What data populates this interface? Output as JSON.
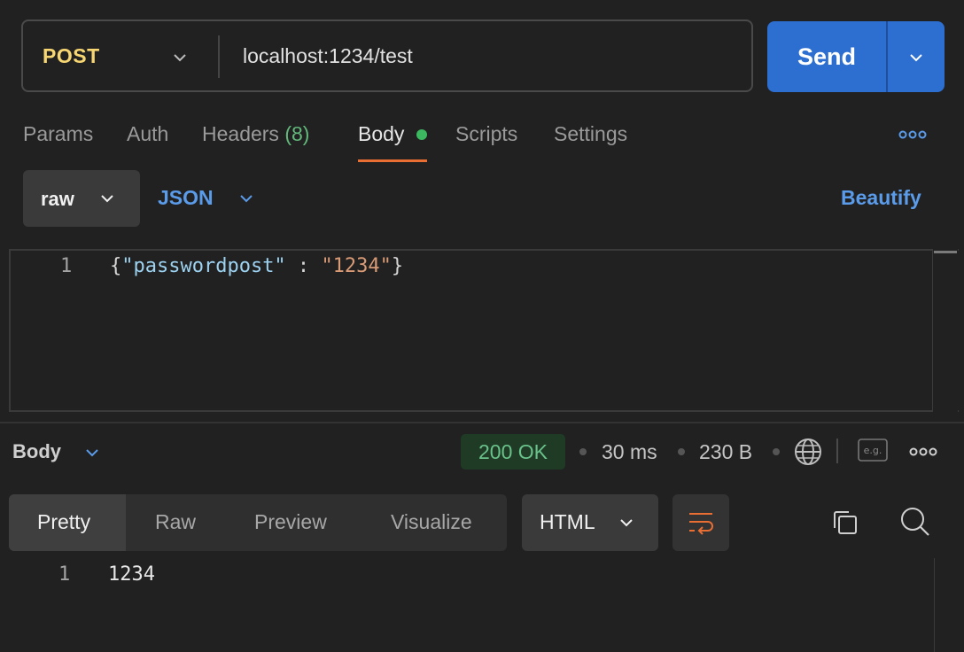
{
  "request": {
    "method": "POST",
    "url": "localhost:1234/test",
    "send_label": "Send"
  },
  "tabs": {
    "params": "Params",
    "auth": "Auth",
    "headers": "Headers",
    "headers_count": "(8)",
    "body": "Body",
    "scripts": "Scripts",
    "settings": "Settings"
  },
  "body_options": {
    "mode": "raw",
    "format": "JSON",
    "beautify": "Beautify"
  },
  "editor": {
    "line_number": "1",
    "brace_open": "{",
    "key": "\"passwordpost\"",
    "colon": " : ",
    "value": "\"1234\"",
    "brace_close": "}"
  },
  "response": {
    "label": "Body",
    "status": "200 OK",
    "time": "30 ms",
    "size": "230 B",
    "eg_label": "e.g.",
    "view_tabs": [
      "Pretty",
      "Raw",
      "Preview",
      "Visualize"
    ],
    "language": "HTML",
    "line_number": "1",
    "content": "1234"
  },
  "colors": {
    "accent_blue": "#2c6fd1",
    "method_yellow": "#f8d773",
    "status_green": "#69c28a",
    "tab_underline": "#e86e34"
  },
  "icons": [
    "chevron-down-icon",
    "more-icon",
    "globe-icon",
    "wrap-icon",
    "copy-icon",
    "search-icon"
  ]
}
